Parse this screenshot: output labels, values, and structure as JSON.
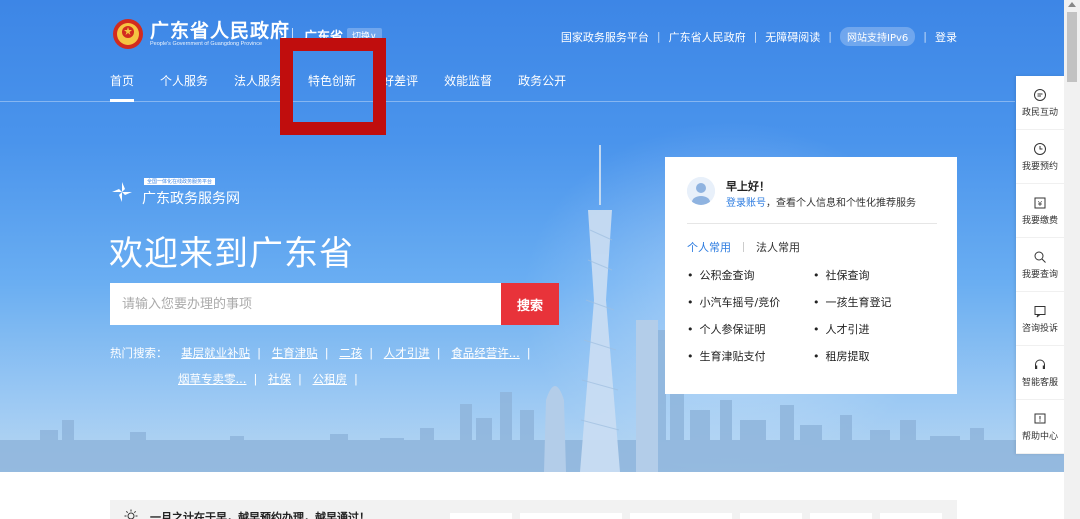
{
  "header": {
    "title": "广东省人民政府",
    "subtitle": "People's Government of Guangdong Province",
    "region": "广东省",
    "region_switch": "切换∨",
    "top_links": [
      "国家政务服务平台",
      "广东省人民政府",
      "无障碍阅读",
      "网站支持IPv6",
      "登录"
    ]
  },
  "nav": {
    "items": [
      "首页",
      "个人服务",
      "法人服务",
      "特色创新",
      "好差评",
      "效能监督",
      "政务公开"
    ],
    "active": "首页"
  },
  "hero": {
    "service_badge": "全国一体化在线政务服务平台",
    "service_name": "广东政务服务网",
    "welcome": "欢迎来到广东省",
    "search_placeholder": "请输入您要办理的事项",
    "search_button": "搜索",
    "hot_label": "热门搜索：",
    "hot_row1": [
      "基层就业补贴",
      "生育津贴",
      "二孩",
      "人才引进",
      "食品经营许..."
    ],
    "hot_row2": [
      "烟草专卖零...",
      "社保",
      "公租房"
    ]
  },
  "card": {
    "greeting": "早上好！",
    "login_link": "登录账号",
    "login_text": "，查看个人信息和个性化推荐服务",
    "tab_active": "个人常用",
    "tab_other": "法人常用",
    "services": [
      "公积金查询",
      "社保查询",
      "小汽车摇号/竞价",
      "一孩生育登记",
      "个人参保证明",
      "人才引进",
      "生育津贴支付",
      "租房提取"
    ]
  },
  "sidebar": {
    "items": [
      {
        "label": "政民互动",
        "icon": "chat-icon"
      },
      {
        "label": "我要预约",
        "icon": "clock-icon"
      },
      {
        "label": "我要缴费",
        "icon": "pay-icon"
      },
      {
        "label": "我要查询",
        "icon": "search-icon"
      },
      {
        "label": "咨询投诉",
        "icon": "message-icon"
      },
      {
        "label": "智能客服",
        "icon": "headset-icon"
      },
      {
        "label": "帮助中心",
        "icon": "help-icon"
      }
    ]
  },
  "notice": {
    "text": "一月之计在于早，越早预约办理，越早通过！"
  },
  "colors": {
    "primary_blue": "#3d86e6",
    "search_red": "#e8333a",
    "link_blue": "#2d7ce0",
    "highlight_box": "#c00d0d"
  }
}
